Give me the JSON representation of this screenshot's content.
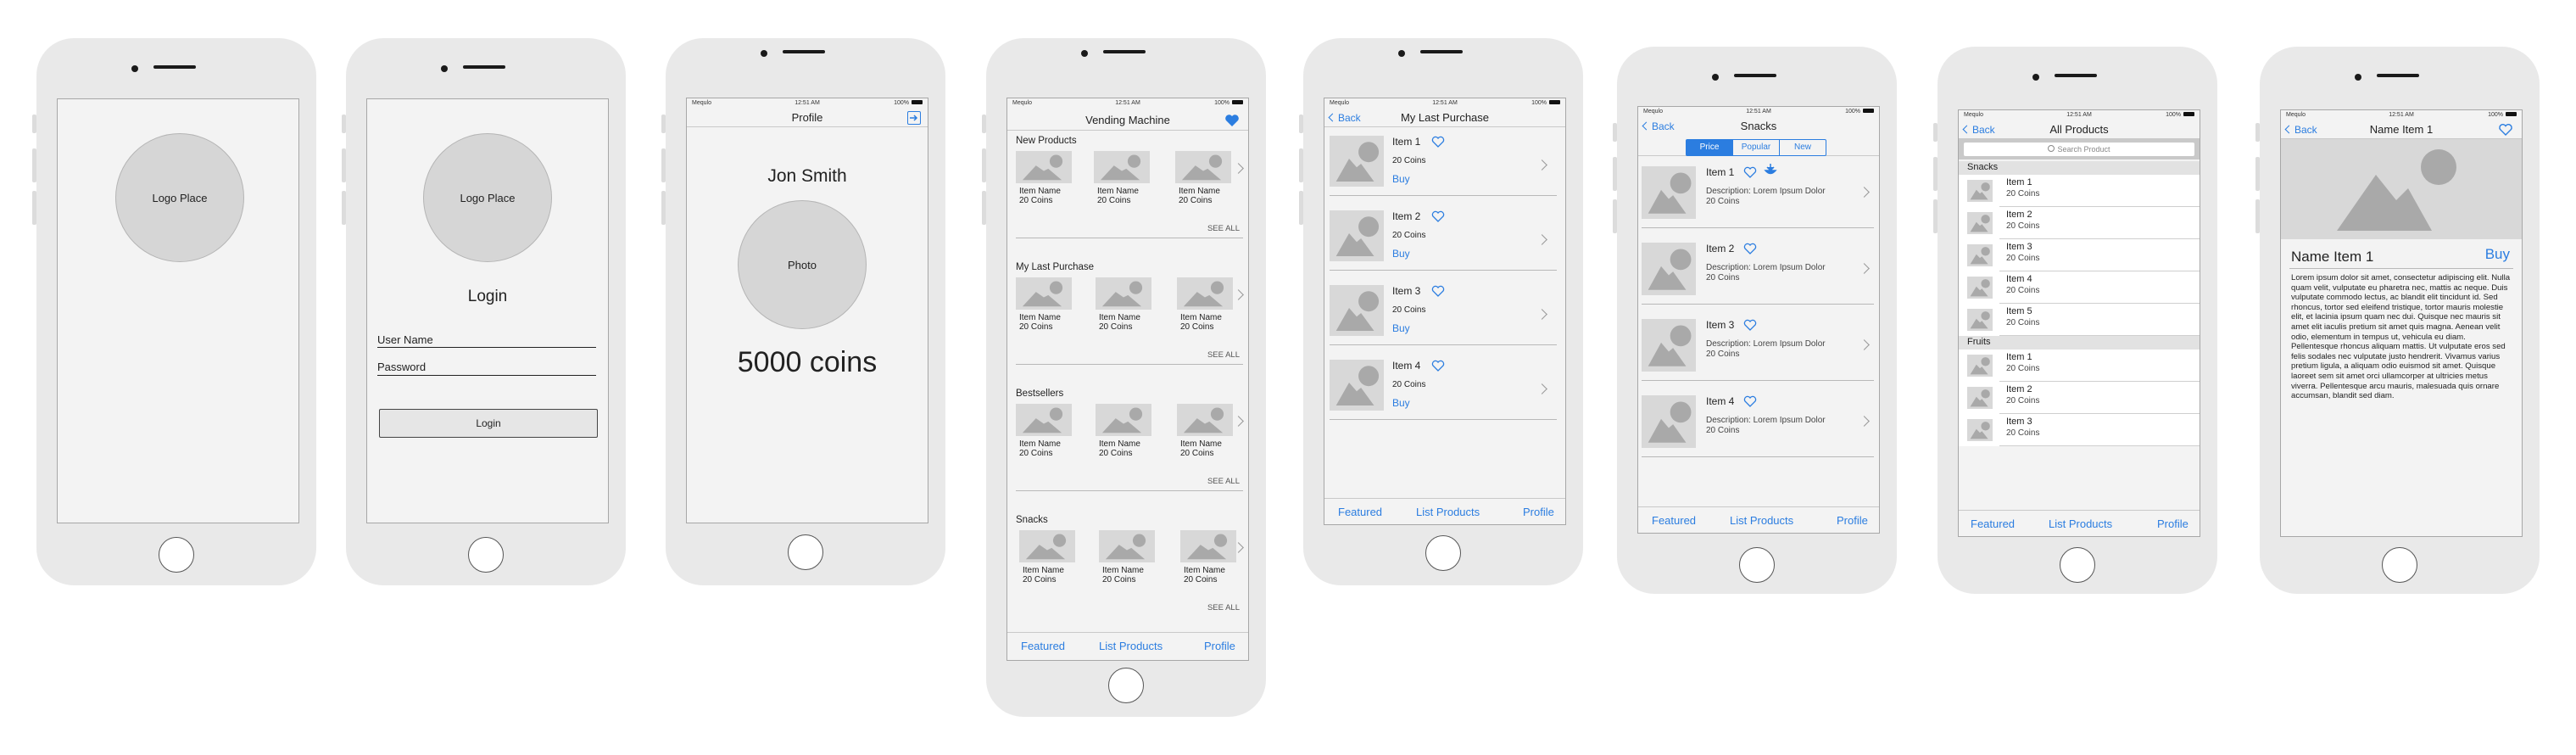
{
  "status": {
    "carrier": "Mequlo",
    "time": "12:51 AM",
    "battery": "100%"
  },
  "logo_screen": {
    "logo": "Logo Place"
  },
  "login_screen": {
    "logo": "Logo Place",
    "title": "Login",
    "username_label": "User Name",
    "password_label": "Password",
    "button": "Login"
  },
  "profile_screen": {
    "nav_title": "Profile",
    "name": "Jon Smith",
    "photo": "Photo",
    "coins": "5000 coins"
  },
  "vending_screen": {
    "nav_title": "Vending Machine",
    "see_all": "SEE ALL",
    "sections": [
      {
        "title": "New Products",
        "items": [
          {
            "name": "Item Name",
            "price": "20 Coins"
          },
          {
            "name": "Item Name",
            "price": "20 Coins"
          },
          {
            "name": "Item Name",
            "price": "20 Coins"
          }
        ]
      },
      {
        "title": "My Last Purchase",
        "items": [
          {
            "name": "Item Name",
            "price": "20 Coins"
          },
          {
            "name": "Item Name",
            "price": "20 Coins"
          },
          {
            "name": "Item Name",
            "price": "20 Coins"
          }
        ]
      },
      {
        "title": "Bestsellers",
        "items": [
          {
            "name": "Item Name",
            "price": "20 Coins"
          },
          {
            "name": "Item Name",
            "price": "20 Coins"
          },
          {
            "name": "Item Name",
            "price": "20 Coins"
          }
        ]
      },
      {
        "title": "Snacks",
        "items": [
          {
            "name": "Item Name",
            "price": "20 Coins"
          },
          {
            "name": "Item Name",
            "price": "20 Coins"
          },
          {
            "name": "Item Name",
            "price": "20 Coins"
          }
        ]
      }
    ]
  },
  "tabs": {
    "featured": "Featured",
    "list": "List Products",
    "profile": "Profile"
  },
  "last_purchase_screen": {
    "back": "Back",
    "nav_title": "My Last Purchase",
    "items": [
      {
        "name": "Item 1",
        "price": "20 Coins",
        "buy": "Buy"
      },
      {
        "name": "Item 2",
        "price": "20 Coins",
        "buy": "Buy"
      },
      {
        "name": "Item 3",
        "price": "20 Coins",
        "buy": "Buy"
      },
      {
        "name": "Item 4",
        "price": "20 Coins",
        "buy": "Buy"
      }
    ]
  },
  "snacks_screen": {
    "back": "Back",
    "nav_title": "Snacks",
    "segments": [
      "Price",
      "Popular",
      "New"
    ],
    "selected_segment": "Price",
    "items": [
      {
        "name": "Item 1",
        "desc": "Description:  Lorem Ipsum Dolor",
        "price": "20 Coins"
      },
      {
        "name": "Item 2",
        "desc": "Description:  Lorem Ipsum Dolor",
        "price": "20 Coins"
      },
      {
        "name": "Item 3",
        "desc": "Description:  Lorem Ipsum Dolor",
        "price": "20 Coins"
      },
      {
        "name": "Item 4",
        "desc": "Description:  Lorem Ipsum Dolor",
        "price": "20 Coins"
      }
    ]
  },
  "all_products_screen": {
    "back": "Back",
    "nav_title": "All Products",
    "search_placeholder": "Search Product",
    "groups": [
      {
        "title": "Snacks",
        "items": [
          {
            "name": "Item 1",
            "price": "20 Coins"
          },
          {
            "name": "Item 2",
            "price": "20 Coins"
          },
          {
            "name": "Item 3",
            "price": "20 Coins"
          },
          {
            "name": "Item 4",
            "price": "20 Coins"
          },
          {
            "name": "Item 5",
            "price": "20 Coins"
          }
        ]
      },
      {
        "title": "Fruits",
        "items": [
          {
            "name": "Item 1",
            "price": "20 Coins"
          },
          {
            "name": "Item 2",
            "price": "20 Coins"
          },
          {
            "name": "Item 3",
            "price": "20 Coins"
          }
        ]
      }
    ]
  },
  "detail_screen": {
    "back": "Back",
    "nav_title": "Name Item 1",
    "name": "Name Item 1",
    "buy": "Buy",
    "description": "Lorem ipsum dolor sit amet, consectetur adipiscing elit. Nulla quam velit, vulputate eu pharetra nec, mattis ac neque. Duis vulputate commodo lectus, ac blandit elit tincidunt id. Sed rhoncus, tortor sed eleifend tristique, tortor mauris molestie elit, et lacinia ipsum quam nec dui. Quisque nec mauris sit amet elit iaculis pretium sit amet quis magna. Aenean velit odio, elementum in tempus ut, vehicula eu diam. Pellentesque rhoncus aliquam mattis. Ut vulputate eros sed felis sodales nec vulputate justo hendrerit. Vivamus varius pretium ligula, a aliquam odio euismod sit amet. Quisque laoreet sem sit amet orci ullamcorper at ultricies metus viverra. Pellentesque arcu mauris, malesuada quis ornare accumsan, blandit sed diam."
  },
  "colors": {
    "accent": "#2b7de0",
    "phone_body": "#e9e9e9",
    "screen": "#f3f3f3",
    "placeholder": "#d8d8d8"
  }
}
